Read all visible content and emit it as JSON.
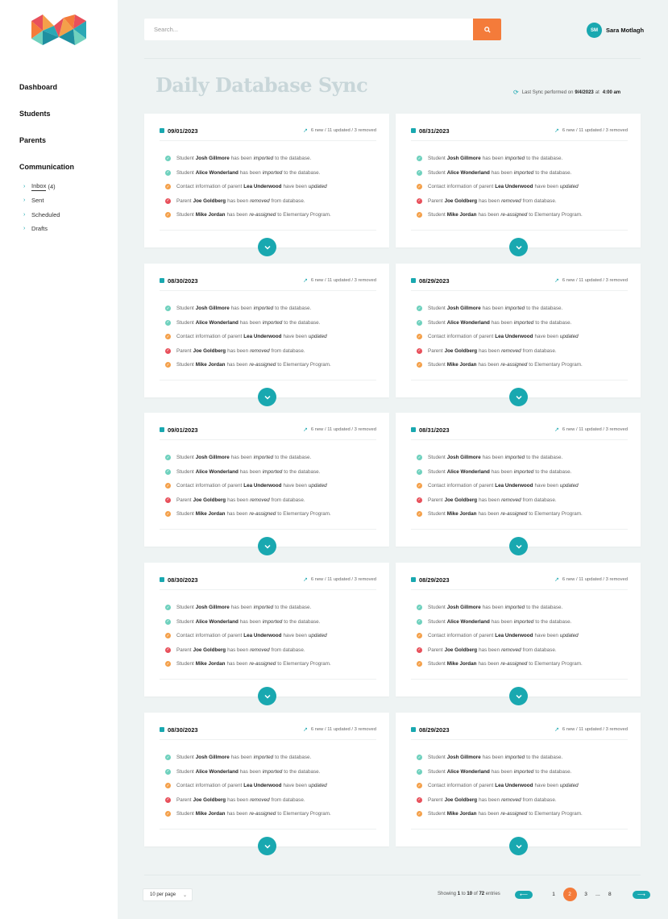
{
  "colors": {
    "teal": "#19a8b0",
    "orange": "#f47b3a",
    "red": "#e8505b",
    "green_check": "#6fd1be",
    "title_gray": "#c8d6d9"
  },
  "sidebar": {
    "logo_icon": "multicolor-m-logo",
    "nav": [
      "Dashboard",
      "Students",
      "Parents",
      "Communication"
    ],
    "sub_nav": [
      {
        "label": "Inbox",
        "count": "(4)",
        "icon": "chevron-right-icon"
      },
      {
        "label": "Sent",
        "count": "",
        "icon": "chevron-right-icon"
      },
      {
        "label": "Scheduled",
        "count": "",
        "icon": "chevron-right-icon"
      },
      {
        "label": "Drafts",
        "count": "",
        "icon": "chevron-right-icon"
      }
    ]
  },
  "header": {
    "search_placeholder": "Search...",
    "search_icon": "search-icon",
    "user_initials": "SM",
    "user_name": "Sara Motlagh"
  },
  "page": {
    "title": "Daily Database Sync",
    "last_sync_prefix": "Last Sync performed on",
    "last_sync_date": "9/4/2023",
    "last_sync_at": "at",
    "last_sync_time": "4:00 am"
  },
  "cards": [
    {
      "date": "09/01/2023",
      "stats": "6 new / 11 updated / 3 removed"
    },
    {
      "date": "08/31/2023",
      "stats": "6 new / 11 updated / 3 removed"
    },
    {
      "date": "08/30/2023",
      "stats": "6 new / 11 updated / 3 removed"
    },
    {
      "date": "08/29/2023",
      "stats": "6 new / 11 updated / 3 removed"
    },
    {
      "date": "09/01/2023",
      "stats": "6 new / 11 updated / 3 removed"
    },
    {
      "date": "08/31/2023",
      "stats": "6 new / 11 updated / 3 removed"
    },
    {
      "date": "08/30/2023",
      "stats": "6 new / 11 updated / 3 removed"
    },
    {
      "date": "08/29/2023",
      "stats": "6 new / 11 updated / 3 removed"
    },
    {
      "date": "08/30/2023",
      "stats": "6 new / 11 updated / 3 removed"
    },
    {
      "date": "08/29/2023",
      "stats": "6 new / 11 updated / 3 removed"
    }
  ],
  "events": [
    {
      "status": "imported",
      "color": "#6fd1be",
      "icon": "check-circle-icon",
      "pre": "Student",
      "name": "Josh Gillmore",
      "mid": "has been",
      "action": "imported",
      "post": "to the database."
    },
    {
      "status": "imported",
      "color": "#6fd1be",
      "icon": "check-circle-icon",
      "pre": "Student",
      "name": "Alice Wonderland",
      "mid": "has been",
      "action": "imported",
      "post": "to the database."
    },
    {
      "status": "updated",
      "color": "#f4a04a",
      "icon": "check-circle-icon",
      "pre": "Contact information of parent",
      "name": "Lea Underwood",
      "mid": "have been",
      "action": "updated",
      "post": ""
    },
    {
      "status": "removed",
      "color": "#e8505b",
      "icon": "check-circle-icon",
      "pre": "Parent",
      "name": "Joe Goldberg",
      "mid": "has been",
      "action": "removed",
      "post": "from database."
    },
    {
      "status": "reassigned",
      "color": "#f4a04a",
      "icon": "check-circle-icon",
      "pre": "Student",
      "name": "Mike Jordan",
      "mid": "has been",
      "action": "re-assigned",
      "post": "to Elementary Program."
    }
  ],
  "footer": {
    "per_page": "10 per page",
    "showing_prefix": "Showing",
    "showing_from": "1",
    "showing_to_word": "to",
    "showing_to": "10",
    "showing_of_word": "of",
    "showing_total": "72",
    "showing_suffix": "entries",
    "pages": [
      "1",
      "2",
      "3"
    ],
    "current_page": "2",
    "ellipsis": "...",
    "last_page": "8",
    "prev_icon": "arrow-left-icon",
    "next_icon": "arrow-right-icon"
  }
}
